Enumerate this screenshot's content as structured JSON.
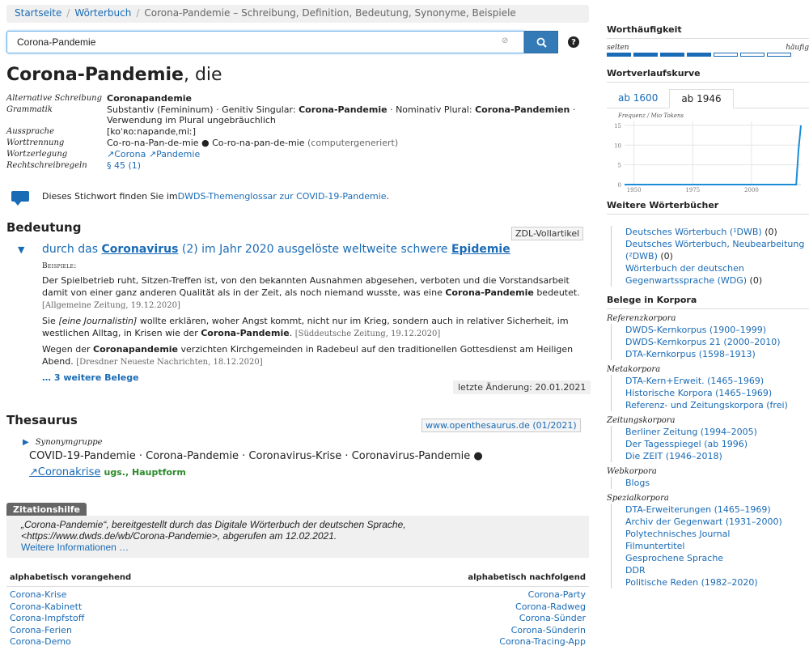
{
  "breadcrumb": {
    "home": "Startseite",
    "dict": "Wörterbuch",
    "current": "Corona-Pandemie – Schreibung, Definition, Bedeutung, Synonyme, Beispiele"
  },
  "search": {
    "value": "Corona-Pandemie",
    "clear": "⊘"
  },
  "headword": {
    "lemma": "Corona-Pandemie",
    "article": ", die"
  },
  "grammar": {
    "alt_label": "Alternative Schreibung",
    "alt_value": "Coronapandemie",
    "gram_label": "Grammatik",
    "gram_1": "Substantiv (Femininum) · Genitiv Singular: ",
    "gram_gen": "Corona-Pandemie",
    "gram_2": " · Nominativ Plural: ",
    "gram_pl": "Corona-Pandemien",
    "gram_3": " · Verwendung im Plural ungebräuchlich",
    "ausspr_label": "Aussprache",
    "ausspr_value": "[koˈʀoːnapandeˌmiː]",
    "trenn_label": "Worttrennung",
    "trenn_value": "Co-ro-na-Pan-de-mie ● Co-ro-na-pan-de-mie",
    "trenn_note": " (computergeneriert)",
    "zerl_label": "Wortzerlegung",
    "zerl_1": "↗Corona",
    "zerl_2": "↗Pandemie",
    "regel_label": "Rechtschreibregeln",
    "regel_value": "§ 45 (1)"
  },
  "glossar": {
    "text": "Dieses Stichwort finden Sie im ",
    "link": "DWDS-Themenglossar zur COVID-19-Pandemie",
    "end": "."
  },
  "bedeutung": {
    "title": "Bedeutung",
    "tag": "ZDL-Vollartikel",
    "sense_1": "durch das ",
    "sense_corona": "Coronavirus",
    "sense_2": " (2) im Jahr 2020 ausgelöste weltweite schwere ",
    "sense_epidemie": "Epidemie",
    "beispiele": "Beispiele:",
    "ex1_1": "Der Spielbetrieb ruht, Sitzen-Treffen ist, von den bekannten Ausnahmen abgesehen, verboten und die Vorstandsarbeit damit von einer ganz anderen Qualität als in der Zeit, als noch niemand wusste, was eine ",
    "ex1_b": "Corona-Pandemie",
    "ex1_2": " bedeutet. ",
    "ex1_src": "[Allgemeine Zeitung, 19.12.2020]",
    "ex2_1": "Sie ",
    "ex2_i": "[eine Journalistin]",
    "ex2_2": " wollte erklären, woher Angst kommt, nicht nur im Krieg, sondern auch in relativer Sicherheit, im westlichen Alltag, in Krisen wie der ",
    "ex2_b": "Corona-Pandemie",
    "ex2_3": ". ",
    "ex2_src": "[Süddeutsche Zeitung, 19.12.2020]",
    "ex3_1": "Wegen der ",
    "ex3_b": "Coronapandemie",
    "ex3_2": " verzichten Kirchgemeinden in Radebeul auf den traditionellen Gottesdienst am Heiligen Abend. ",
    "ex3_src": "[Dresdner Neueste Nachrichten, 18.12.2020]",
    "more": "… 3 weitere Belege",
    "last_change": "letzte Änderung: 20.01.2021"
  },
  "thesaurus": {
    "title": "Thesaurus",
    "source": "www.openthesaurus.de (01/2021)",
    "group_label": "Synonymgruppe",
    "syns": "COVID-19-Pandemie · Corona-Pandemie · Coronavirus-Krise · Coronavirus-Pandemie ●",
    "link": "↗Coronakrise",
    "tags": "ugs., Hauptform"
  },
  "zitation": {
    "tab": "Zitationshilfe",
    "line1": "„Corona-Pandemie“, bereitgestellt durch das Digitale Wörterbuch der deutschen Sprache,",
    "line2": "<https://www.dwds.de/wb/Corona-Pandemie>, abgerufen am 12.02.2021.",
    "more": "Weitere Informationen …"
  },
  "alpha": {
    "before_label": "alphabetisch vorangehend",
    "after_label": "alphabetisch nachfolgend",
    "before": [
      "Corona-Krise",
      "Corona-Kabinett",
      "Corona-Impfstoff",
      "Corona-Ferien",
      "Corona-Demo"
    ],
    "after": [
      "Corona-Party",
      "Corona-Radweg",
      "Corona-Sünder",
      "Corona-Sünderin",
      "Corona-Tracing-App"
    ]
  },
  "sidebar": {
    "freq_title": "Worthäufigkeit",
    "freq_low": "selten",
    "freq_high": "häufig",
    "freq_level": 4,
    "freq_total": 7,
    "verlauf_title": "Wortverlaufskurve",
    "tab_1600": "ab 1600",
    "tab_1946": "ab 1946",
    "chart_ylabel": "Frequenz / Mio Tokens",
    "chart_yticks": [
      "15",
      "10",
      "5",
      "0"
    ],
    "chart_xticks": [
      "1950",
      "1975",
      "2000"
    ],
    "weitere_title": "Weitere Wörterbücher",
    "weitere": [
      {
        "name": "Deutsches Wörterbuch (¹DWB)",
        "count": " (0)"
      },
      {
        "name": "Deutsches Wörterbuch, Neubearbeitung (²DWB)",
        "count": " (0)"
      },
      {
        "name": "Wörterbuch der deutschen Gegenwartssprache (WDG)",
        "count": " (0)"
      }
    ],
    "korpora_title": "Belege in Korpora",
    "ref_label": "Referenzkorpora",
    "ref": [
      "DWDS-Kernkorpus (1900–1999)",
      "DWDS-Kernkorpus 21 (2000–2010)",
      "DTA-Kernkorpus (1598–1913)"
    ],
    "meta_label": "Metakorpora",
    "meta": [
      "DTA-Kern+Erweit. (1465–1969)",
      "Historische Korpora (1465–1969)",
      "Referenz- und Zeitungskorpora (frei)"
    ],
    "zeit_label": "Zeitungskorpora",
    "zeit": [
      "Berliner Zeitung (1994–2005)",
      "Der Tagesspiegel (ab 1996)",
      "Die ZEIT (1946–2018)"
    ],
    "web_label": "Webkorpora",
    "web": [
      "Blogs"
    ],
    "spez_label": "Spezialkorpora",
    "spez": [
      "DTA-Erweiterungen (1465–1969)",
      "Archiv der Gegenwart (1931–2000)",
      "Polytechnisches Journal",
      "Filmuntertitel",
      "Gesprochene Sprache",
      "DDR",
      "Politische Reden (1982–2020)"
    ]
  },
  "colors": {
    "link": "#1a6bb5",
    "accent": "#337ab7",
    "curve": "#1a8cd8"
  },
  "chart_data": {
    "type": "line",
    "ylabel": "Frequenz / Mio Tokens",
    "x": [
      1946,
      1960,
      1980,
      2000,
      2015,
      2019,
      2020,
      2021
    ],
    "values": [
      0,
      0,
      0,
      0,
      0,
      0,
      9,
      15
    ],
    "xlim": [
      1946,
      2021
    ],
    "ylim": [
      0,
      16
    ]
  }
}
